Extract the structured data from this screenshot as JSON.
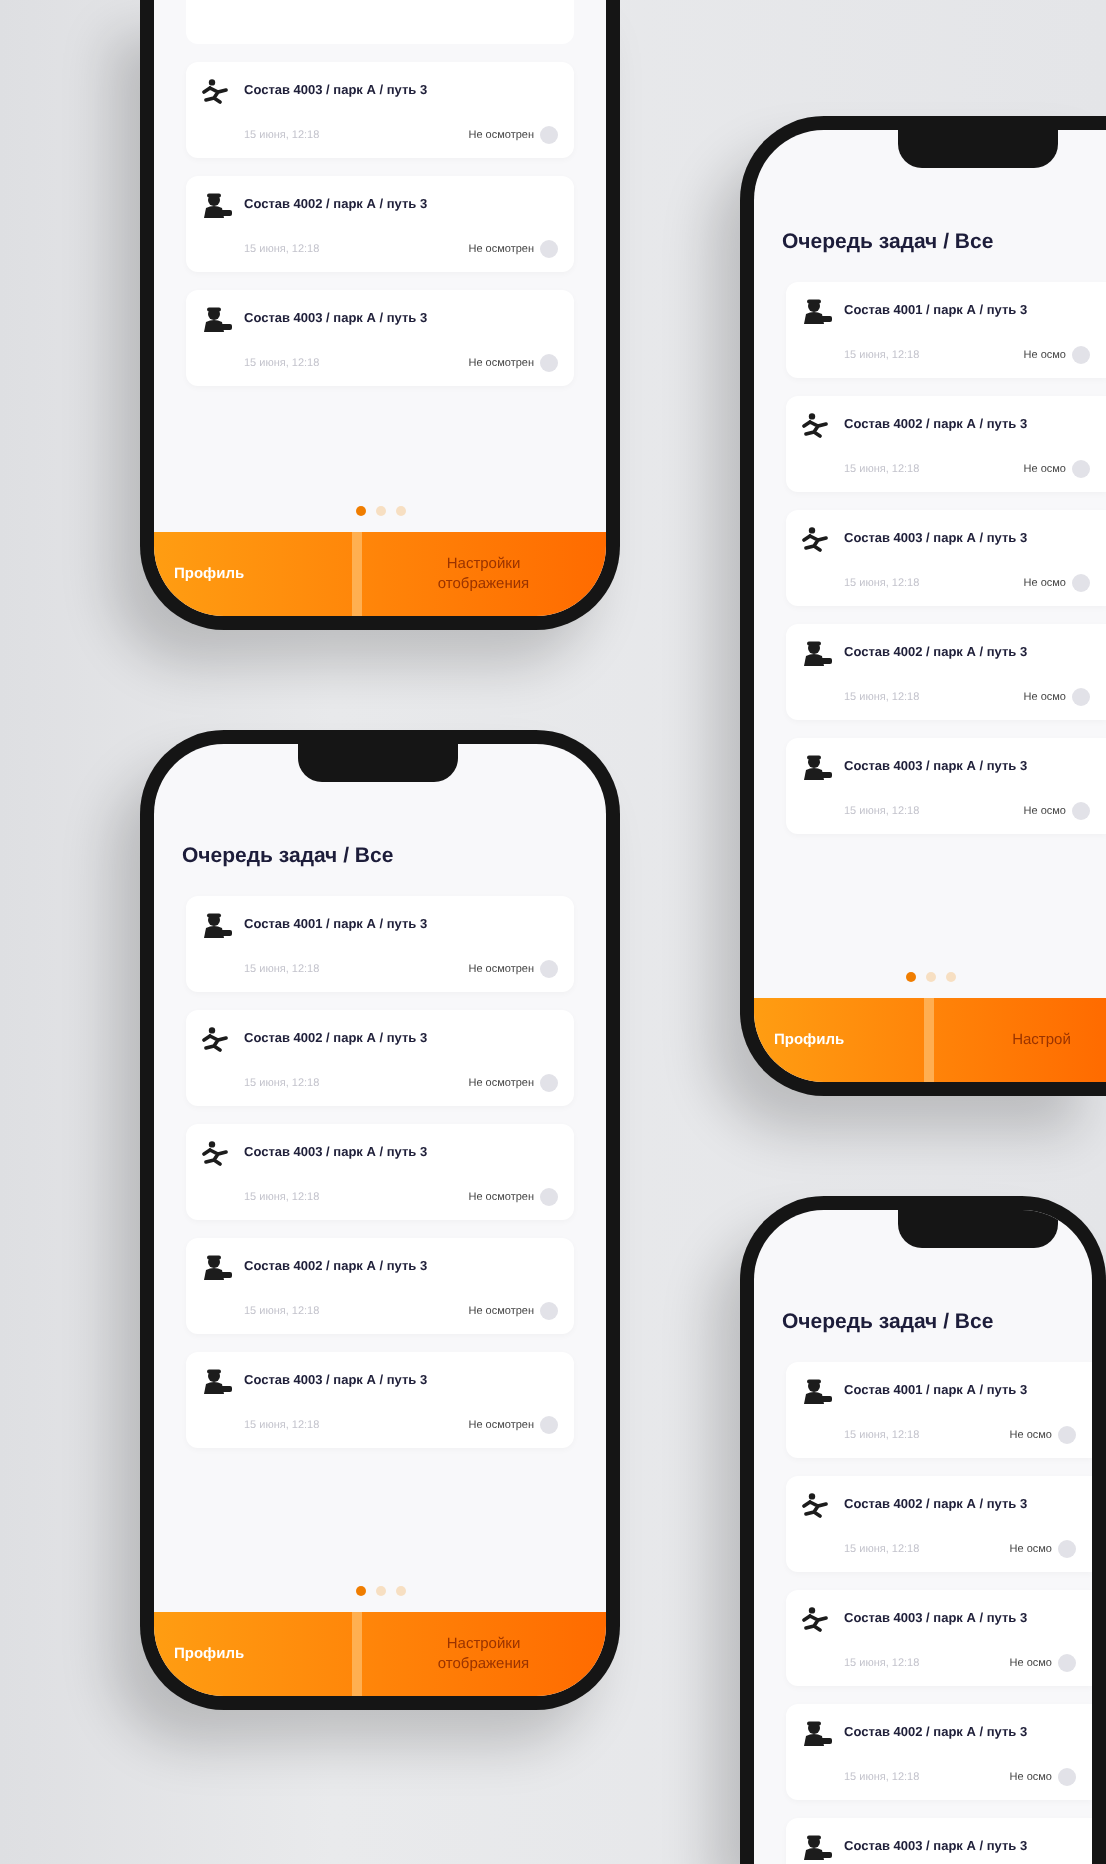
{
  "phones": [
    {
      "kind": "top_cut",
      "tasks": [
        {
          "kind": "runner",
          "title": "Состав 4003 / парк А / путь 3",
          "date": "15 июня, 12:18",
          "status": "Не осмотрен"
        },
        {
          "kind": "inspector",
          "title": "Состав 4002 / парк А / путь 3",
          "date": "15 июня, 12:18",
          "status": "Не осмотрен"
        },
        {
          "kind": "inspector",
          "title": "Состав 4003 / парк А / путь 3",
          "date": "15 июня, 12:18",
          "status": "Не осмотрен"
        }
      ],
      "dots": [
        {
          "selected": true
        },
        {
          "selected": false
        },
        {
          "selected": false
        }
      ],
      "buttons": [
        {
          "label": "Профиль",
          "selected": true
        },
        {
          "label": "Настройки отображения",
          "selected": false
        }
      ]
    },
    {
      "kind": "full",
      "title": "Очередь задач / Все",
      "tasks": [
        {
          "kind": "inspector",
          "title": "Состав 4001 / парк А / путь 3",
          "date": "15 июня, 12:18",
          "status": "Не осмотрен"
        },
        {
          "kind": "runner",
          "title": "Состав 4002 / парк А / путь 3",
          "date": "15 июня, 12:18",
          "status": "Не осмотрен"
        },
        {
          "kind": "runner",
          "title": "Состав 4003 / парк А / путь 3",
          "date": "15 июня, 12:18",
          "status": "Не осмотрен"
        },
        {
          "kind": "inspector",
          "title": "Состав 4002 / парк А / путь 3",
          "date": "15 июня, 12:18",
          "status": "Не осмотрен"
        },
        {
          "kind": "inspector",
          "title": "Состав 4003 / парк А / путь 3",
          "date": "15 июня, 12:18",
          "status": "Не осмотрен"
        }
      ],
      "dots": [
        {
          "selected": true
        },
        {
          "selected": false
        },
        {
          "selected": false
        }
      ],
      "buttons": [
        {
          "label": "Профиль",
          "selected": true
        },
        {
          "label": "Настройки отображения",
          "selected": false
        }
      ]
    },
    {
      "kind": "right_cut",
      "title": "Очередь задач / Все",
      "tasks": [
        {
          "kind": "inspector",
          "title": "Состав 4001 / парк А / путь 3",
          "date": "15 июня, 12:18",
          "status": "Не осмо"
        },
        {
          "kind": "runner",
          "title": "Состав 4002 / парк А / путь 3",
          "date": "15 июня, 12:18",
          "status": "Не осмо"
        },
        {
          "kind": "runner",
          "title": "Состав 4003 / парк А / путь 3",
          "date": "15 июня, 12:18",
          "status": "Не осмо"
        },
        {
          "kind": "inspector",
          "title": "Состав 4002 / парк А / путь 3",
          "date": "15 июня, 12:18",
          "status": "Не осмо"
        },
        {
          "kind": "inspector",
          "title": "Состав 4003 / парк А / путь 3",
          "date": "15 июня, 12:18",
          "status": "Не осмо"
        }
      ],
      "dots": [
        {
          "selected": true
        },
        {
          "selected": false
        },
        {
          "selected": false
        }
      ],
      "buttons": [
        {
          "label": "Профиль",
          "selected": true
        },
        {
          "label": "Настрой",
          "selected": false
        }
      ]
    },
    {
      "kind": "bottom_cut",
      "title": "Очередь задач / Все",
      "tasks": [
        {
          "kind": "inspector",
          "title": "Состав 4001 / парк А / путь 3",
          "date": "15 июня, 12:18",
          "status": "Не осмо"
        },
        {
          "kind": "runner",
          "title": "Состав 4002 / парк А / путь 3",
          "date": "15 июня, 12:18",
          "status": "Не осмо"
        },
        {
          "kind": "runner",
          "title": "Состав 4003 / парк А / путь 3",
          "date": "15 июня, 12:18",
          "status": "Не осмо"
        },
        {
          "kind": "inspector",
          "title": "Состав 4002 / парк А / путь 3",
          "date": "15 июня, 12:18",
          "status": "Не осмо"
        },
        {
          "kind": "inspector",
          "title": "Состав 4003 / парк А / путь 3"
        }
      ]
    }
  ]
}
